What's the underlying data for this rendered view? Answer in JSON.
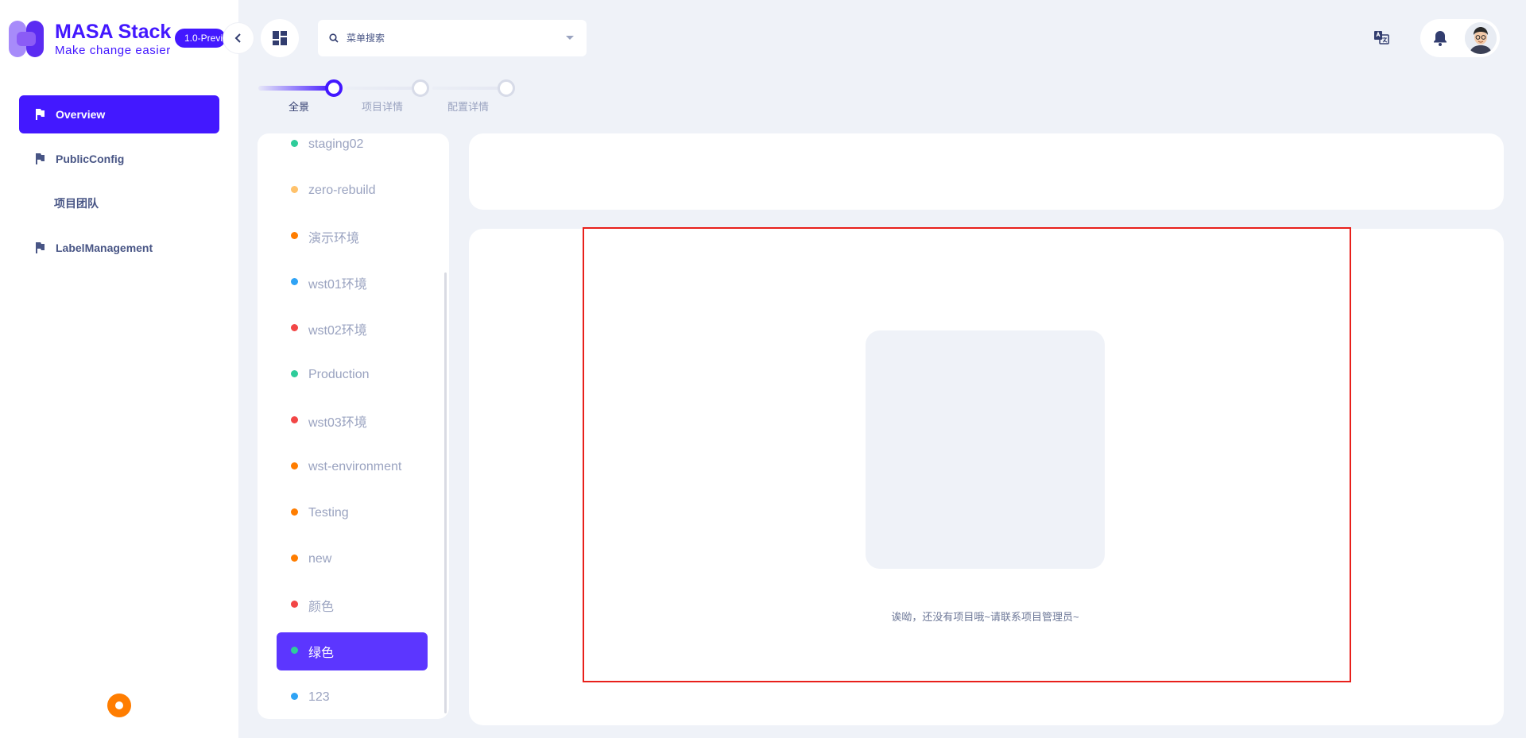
{
  "brand": {
    "name": "MASA Stack",
    "slogan": "Make change easier",
    "version": "1.0-Previ"
  },
  "sidebar": {
    "items": [
      {
        "label": "Overview",
        "icon": "flag-icon",
        "active": true
      },
      {
        "label": "PublicConfig",
        "icon": "flag-icon",
        "active": false
      },
      {
        "label": "项目团队",
        "icon": "",
        "active": false
      },
      {
        "label": "LabelManagement",
        "icon": "flag-icon",
        "active": false
      }
    ]
  },
  "header": {
    "search_placeholder": "菜单搜索"
  },
  "stepper": {
    "steps": [
      {
        "label": "全景",
        "active": true
      },
      {
        "label": "项目详情",
        "active": false
      },
      {
        "label": "配置详情",
        "active": false
      }
    ]
  },
  "environments": [
    {
      "name": "staging02",
      "color": "#2ecc9a"
    },
    {
      "name": "zero-rebuild",
      "color": "#ffc26b"
    },
    {
      "name": "演示环境",
      "color": "#ff7d00"
    },
    {
      "name": "wst01环境",
      "color": "#2fa3f5"
    },
    {
      "name": "wst02环境",
      "color": "#f24646"
    },
    {
      "name": "Production",
      "color": "#2ecc9a"
    },
    {
      "name": "wst03环境",
      "color": "#f24646"
    },
    {
      "name": "wst-environment",
      "color": "#ff7d00"
    },
    {
      "name": "Testing",
      "color": "#ff7d00"
    },
    {
      "name": "new",
      "color": "#ff7d00"
    },
    {
      "name": "颜色",
      "color": "#f24646"
    },
    {
      "name": "绿色",
      "color": "#2ecc9a",
      "active": true
    },
    {
      "name": "123",
      "color": "#2fa3f5"
    }
  ],
  "main": {
    "empty_message": "诶呦，还没有项目哦~请联系项目管理员~"
  },
  "colors": {
    "accent": "#4318ff",
    "highlight_frame": "#e8201b"
  }
}
